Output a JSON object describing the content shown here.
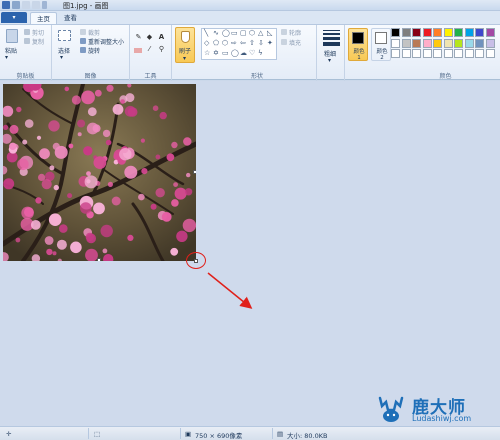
{
  "window": {
    "title": "图1.jpg - 画图"
  },
  "tabs": {
    "app_menu": "▾",
    "home": "主页",
    "view": "查看"
  },
  "ribbon": {
    "clipboard": {
      "paste": "粘贴",
      "cut": "剪切",
      "copy": "复制",
      "label": "剪贴板"
    },
    "image": {
      "select": "选择",
      "crop": "裁剪",
      "resize": "重新调整大小",
      "rotate": "旋转",
      "label": "图像"
    },
    "tools": {
      "label": "工具",
      "text_tool": "A"
    },
    "brush": {
      "label": "刷子"
    },
    "shapes": {
      "outline": "轮廓",
      "fill": "填充",
      "label": "形状"
    },
    "size": {
      "label": "粗细"
    },
    "colors": {
      "color1": "颜色 1",
      "color2": "颜色 2",
      "label": "颜色",
      "color1_value": "#000000",
      "color2_value": "#ffffff",
      "palette": [
        "#000000",
        "#7f7f7f",
        "#880015",
        "#ed1c24",
        "#ff7f27",
        "#fff200",
        "#22b14c",
        "#00a2e8",
        "#3f48cc",
        "#a349a4",
        "#ffffff",
        "#c3c3c3",
        "#b97a57",
        "#ffaec9",
        "#ffc90e",
        "#efe4b0",
        "#b5e61d",
        "#99d9ea",
        "#7092be",
        "#c8bfe7",
        "#ffffff",
        "#ffffff",
        "#ffffff",
        "#ffffff",
        "#ffffff",
        "#ffffff",
        "#ffffff",
        "#ffffff",
        "#ffffff",
        "#ffffff"
      ]
    }
  },
  "canvas": {
    "image_subject": "pink plum blossoms on branches"
  },
  "status": {
    "dimensions": "750 × 690像素",
    "size": "大小: 80.0KB"
  },
  "watermark": {
    "title": "鹿大师",
    "url": "Ludashiwj.com"
  },
  "colors": {
    "accent": "#2b63ad",
    "annotation_red": "#e0201a"
  }
}
